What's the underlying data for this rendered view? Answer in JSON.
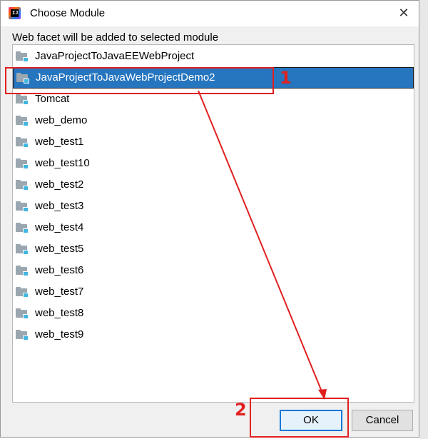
{
  "window": {
    "title": "Choose Module",
    "close_glyph": "✕",
    "app_icon": "intellij-idea-icon"
  },
  "subtitle": "Web facet will be added to selected module",
  "modules": [
    "JavaProjectToJavaEEWebProject",
    "JavaProjectToJavaWebProjectDemo2",
    "Tomcat",
    "web_demo",
    "web_test1",
    "web_test10",
    "web_test2",
    "web_test3",
    "web_test4",
    "web_test5",
    "web_test6",
    "web_test7",
    "web_test8",
    "web_test9"
  ],
  "selected_index": 1,
  "buttons": {
    "ok": "OK",
    "cancel": "Cancel"
  },
  "annotations": {
    "step1": "1",
    "step2": "2"
  },
  "colors": {
    "selection": "#2675bf",
    "annotation": "#e02020",
    "folder": "#9aa7b0",
    "module_marker": "#40b6e0"
  }
}
